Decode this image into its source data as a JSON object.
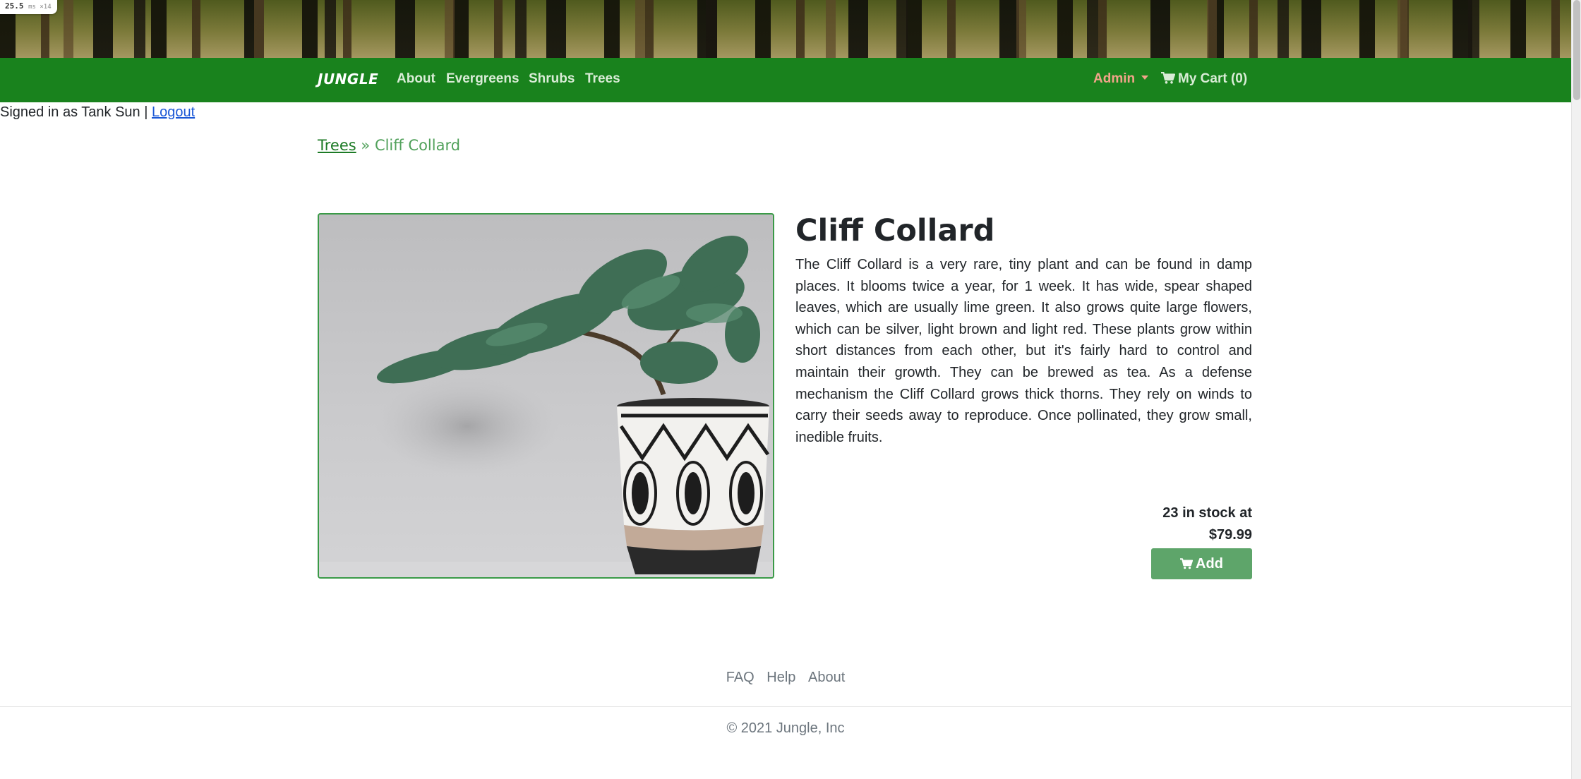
{
  "timing": {
    "value": "25.5",
    "unit": "ms ×14"
  },
  "navbar": {
    "brand": "JUNGLE",
    "links": [
      "About",
      "Evergreens",
      "Shrubs",
      "Trees"
    ],
    "admin": "Admin",
    "cart": "My Cart (0)"
  },
  "session": {
    "signed_in_text": "Signed in as Tank Sun |",
    "logout": "Logout"
  },
  "breadcrumb": {
    "parent": "Trees",
    "separator": "»",
    "current": "Cliff Collard"
  },
  "product": {
    "name": "Cliff Collard",
    "description": "The Cliff Collard is a very rare, tiny plant and can be found in damp places. It blooms twice a year, for 1 week. It has wide, spear shaped leaves, which are usually lime green. It also grows quite large flowers, which can be silver, light brown and light red. These plants grow within short distances from each other, but it's fairly hard to control and maintain their growth. They can be brewed as tea. As a defense mechanism the Cliff Collard grows thick thorns. They rely on winds to carry their seeds away to reproduce. Once pollinated, they grow small, inedible fruits.",
    "stock": "23 in stock at",
    "price": "$79.99",
    "add_label": "Add",
    "image_subject": "bonsai-juniper-in-patterned-pot"
  },
  "footer": {
    "links": [
      "FAQ",
      "Help",
      "About"
    ],
    "copyright": "© 2021 Jungle, Inc"
  },
  "colors": {
    "navbar": "#19821d",
    "admin": "#f2a48a",
    "add_button": "#5ea56a",
    "breadcrumb": "#51a15b",
    "link": "#1a57d6"
  },
  "icons": {
    "cart": "shopping-cart-icon",
    "admin_caret": "caret-down-icon"
  }
}
